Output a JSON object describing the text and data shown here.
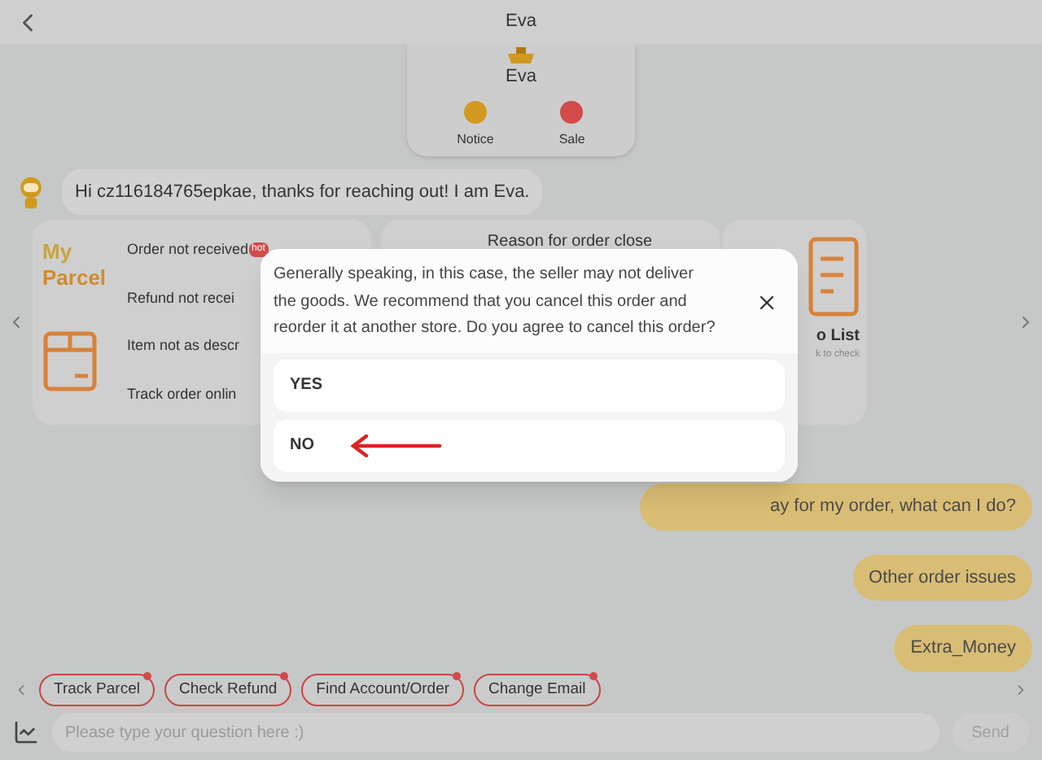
{
  "header": {
    "title": "Eva"
  },
  "profile": {
    "name": "Eva",
    "actions": [
      {
        "label": "Notice",
        "kind": "notice"
      },
      {
        "label": "Sale",
        "kind": "sale"
      }
    ]
  },
  "greeting": "Hi cz116184765epkae, thanks for reaching out! I am Eva.",
  "parcel_card": {
    "title_top": "My",
    "title_bottom": "Parcel",
    "items": [
      {
        "label": "Order not received",
        "badge": "hot"
      },
      {
        "label": "Refund not recei"
      },
      {
        "label": "Item not as descr"
      },
      {
        "label": "Track order onlin"
      }
    ]
  },
  "reason_card": {
    "item": "Reason for order close"
  },
  "todo_card": {
    "title": "o List",
    "subtitle": "k to check"
  },
  "messages": [
    "ay for my order, what can I do?",
    "Other order issues",
    "Extra_Money"
  ],
  "dialog": {
    "text": "Generally speaking, in this case, the seller may not deliver the goods. We recommend that you cancel this order and reorder it at another store. Do you agree to cancel this order?",
    "options": [
      {
        "label": "YES",
        "pointed": false
      },
      {
        "label": "NO",
        "pointed": true
      }
    ]
  },
  "quick_replies": [
    "Track Parcel",
    "Check Refund",
    "Find Account/Order",
    "Change Email"
  ],
  "input": {
    "placeholder": "Please type your question here :)"
  },
  "send": "Send"
}
